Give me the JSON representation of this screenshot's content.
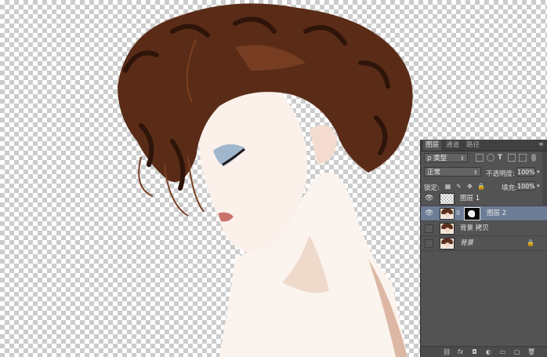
{
  "canvas": {
    "colors": {
      "hair": "#5a2c17",
      "hair_dark": "#3a1a0c",
      "skin": "#f6e6db",
      "skin_shadow": "#c99b83",
      "eye_shadow": "#9eb5cc",
      "lip": "#c9736b"
    }
  },
  "layers_panel": {
    "tabs": [
      {
        "label": "图层",
        "active": true
      },
      {
        "label": "通道",
        "active": false
      },
      {
        "label": "路径",
        "active": false
      }
    ],
    "filter": {
      "label": "ρ 类型"
    },
    "blend_mode": {
      "label": "正常"
    },
    "opacity": {
      "label": "不透明度:",
      "value": "100%"
    },
    "lock": {
      "label": "锁定:"
    },
    "fill": {
      "label": "填充:",
      "value": "100%"
    },
    "layers": [
      {
        "name": "图层 1",
        "visible": true,
        "selected": false,
        "thumbnail": "transparent",
        "has_mask": false
      },
      {
        "name": "图层 2",
        "visible": true,
        "selected": true,
        "thumbnail": "photo",
        "has_mask": true
      },
      {
        "name": "背景 拷贝",
        "visible": false,
        "selected": false,
        "thumbnail": "photo",
        "has_mask": false
      },
      {
        "name": "背景",
        "visible": false,
        "selected": false,
        "thumbnail": "photo",
        "has_mask": false,
        "locked": true,
        "italic": true
      }
    ],
    "glyphs": {
      "eye": "👁",
      "chain": "8",
      "dropdown": "⇕",
      "menu": "≡",
      "lock": "🔒"
    },
    "bottom_icons": [
      "link-icon",
      "fx-icon",
      "add-mask-icon",
      "adjustment-icon",
      "folder-icon",
      "new-layer-icon",
      "trash-icon"
    ]
  }
}
